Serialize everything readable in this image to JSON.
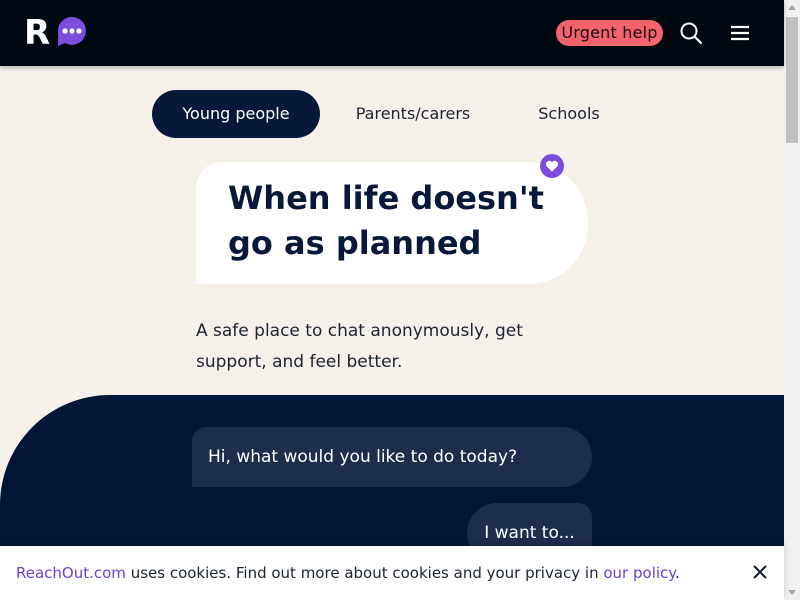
{
  "header": {
    "logo_letter": "R",
    "urgent_label": "Urgent help"
  },
  "icons": {
    "logo": "reachout-logo",
    "search": "search-icon",
    "menu": "hamburger-menu-icon",
    "heart": "heart-icon",
    "close": "close-icon"
  },
  "tabs": [
    {
      "label": "Young people",
      "active": true
    },
    {
      "label": "Parents/carers",
      "active": false
    },
    {
      "label": "Schools",
      "active": false
    }
  ],
  "hero": {
    "title": "When life doesn't go as planned",
    "subtitle": "A safe place to chat anonymously, get support, and feel better."
  },
  "chat": {
    "bot_message": "Hi, what would you like to do today?",
    "user_prompt": "I want to..."
  },
  "cookie_banner": {
    "brand_link": "ReachOut.com",
    "text_middle": " uses cookies. Find out more about cookies and your privacy in ",
    "policy_link": "our policy",
    "text_end": "."
  },
  "colors": {
    "header_bg": "#020811",
    "urgent_bg": "#f2636b",
    "page_bg": "#f6f0ea",
    "navy": "#08183a",
    "accent_purple": "#7c4ddb",
    "chat_bg": "#031638",
    "bubble_bg": "#1d2e4c"
  }
}
